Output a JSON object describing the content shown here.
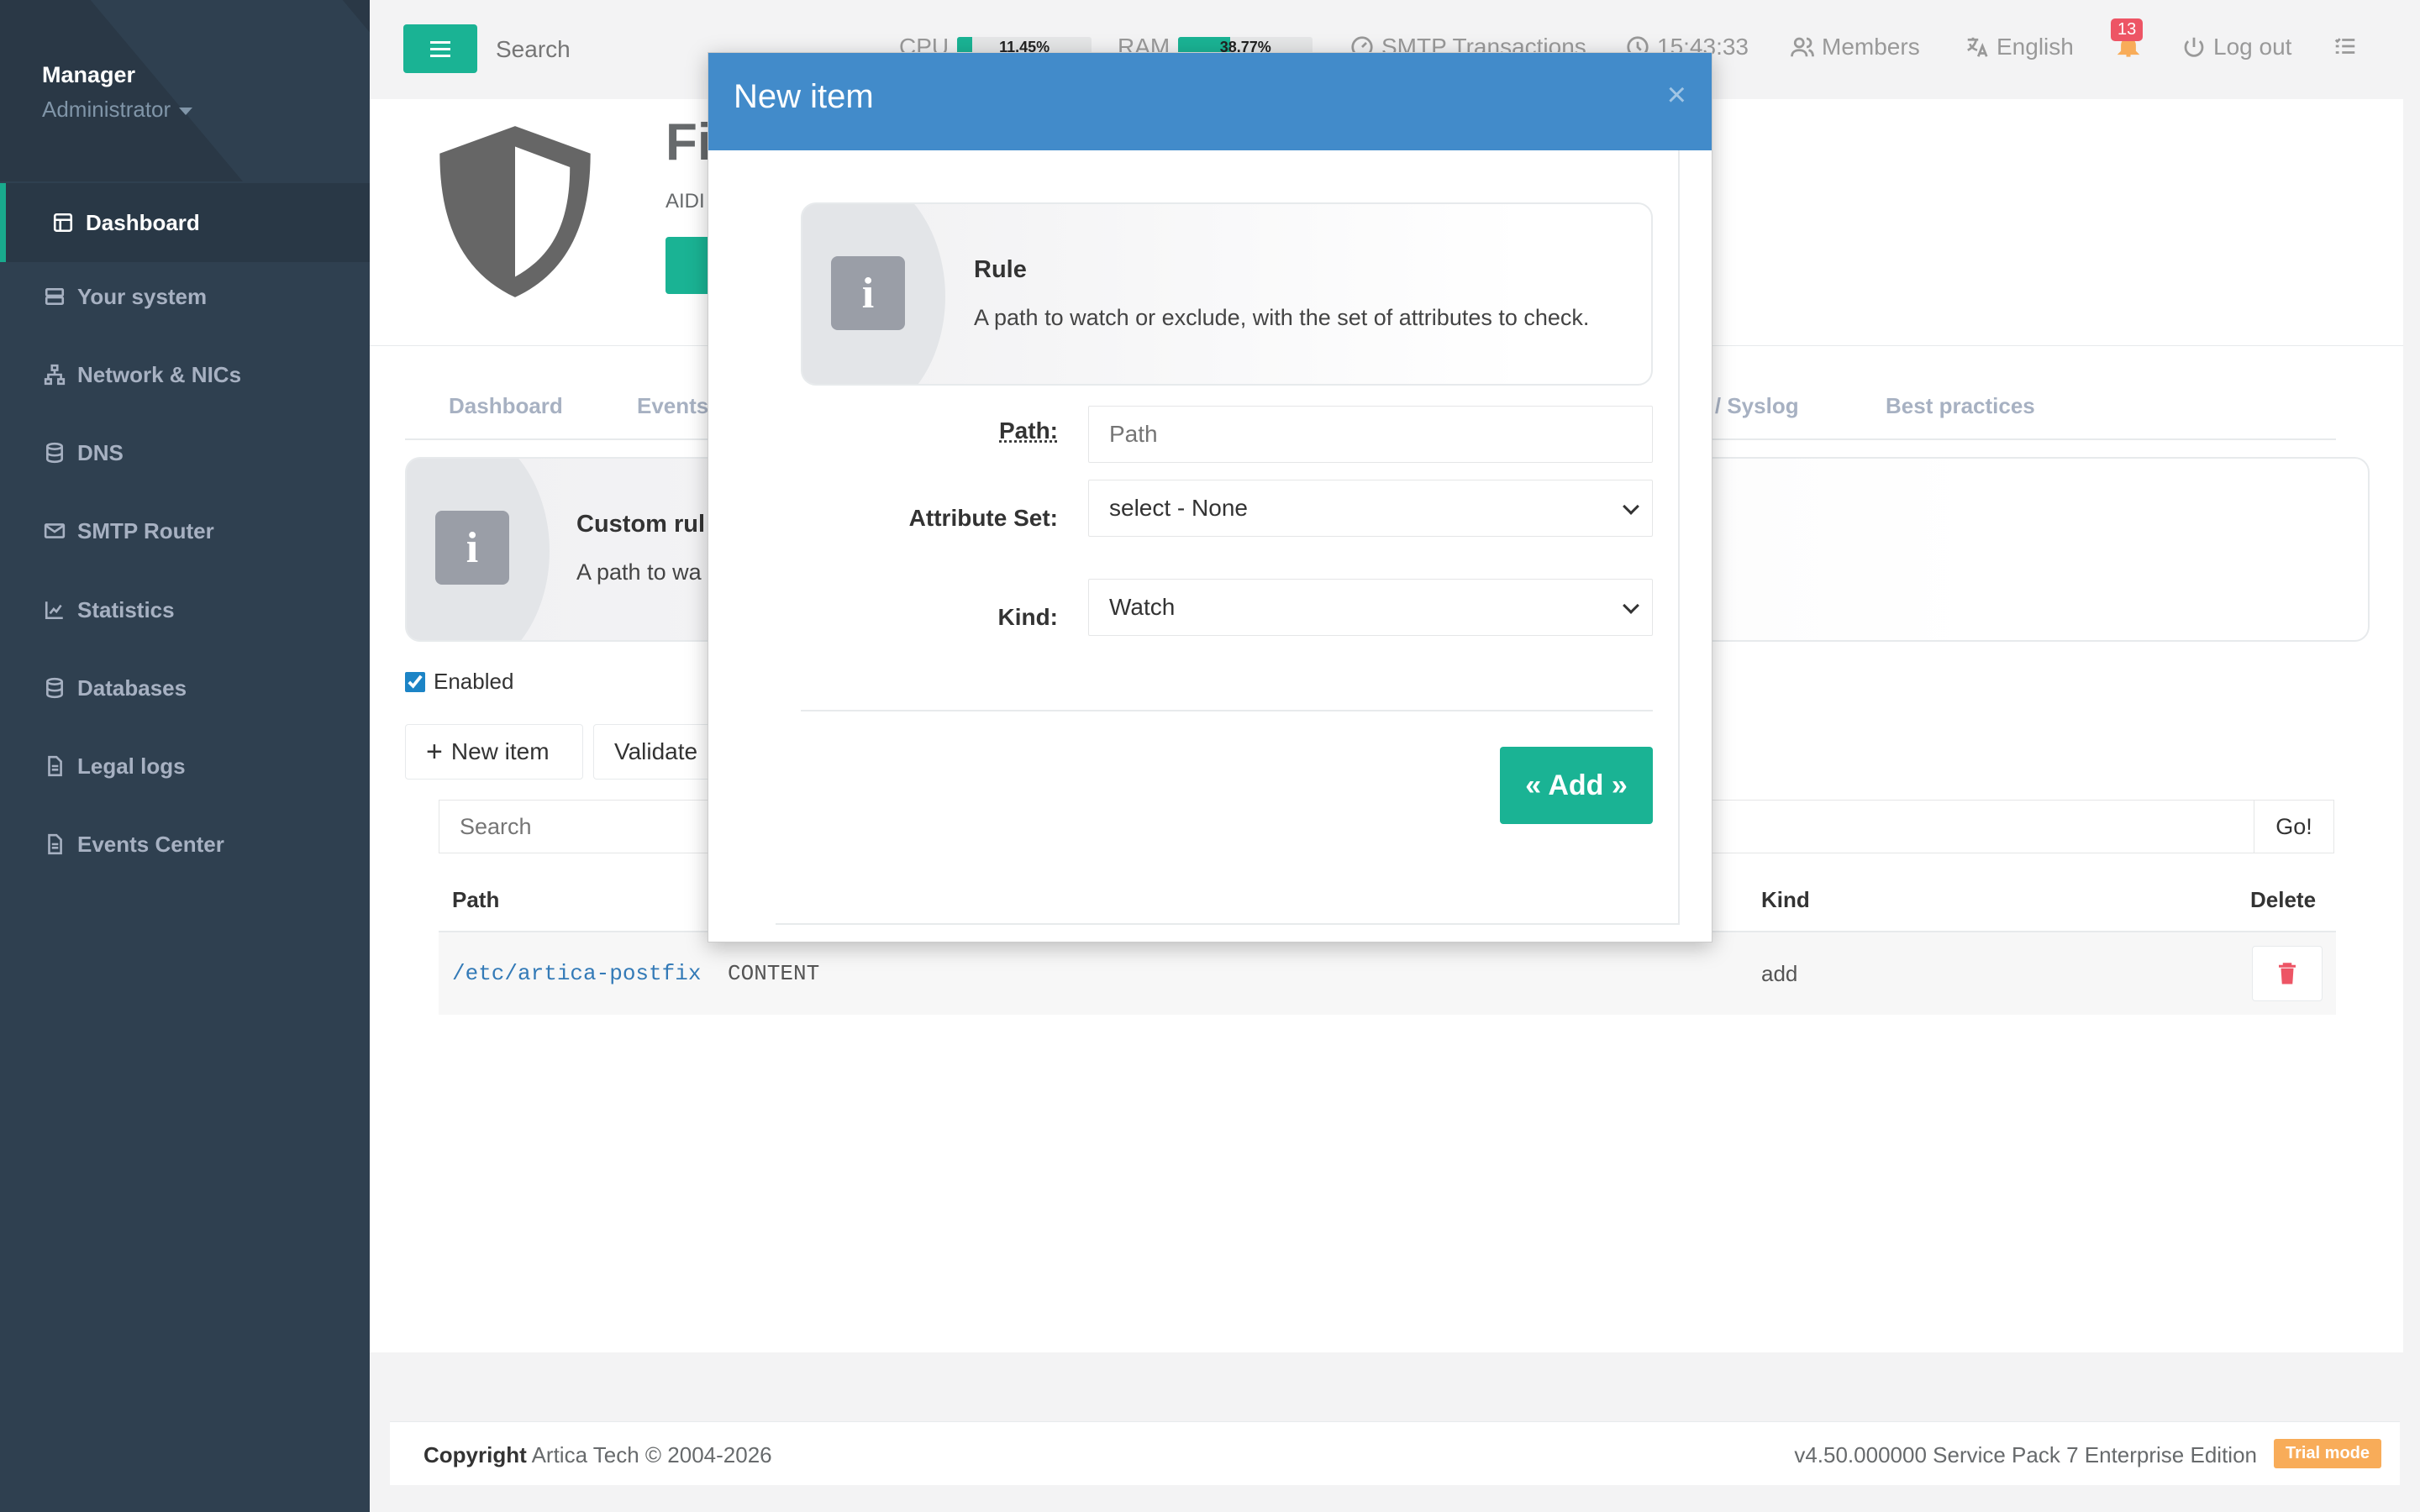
{
  "sidebar": {
    "profile_name": "Manager",
    "profile_role": "Administrator",
    "items": [
      {
        "label": "Dashboard",
        "icon": "dashboard-icon"
      },
      {
        "label": "Your system",
        "icon": "server-icon"
      },
      {
        "label": "Network & NICs",
        "icon": "sitemap-icon"
      },
      {
        "label": "DNS",
        "icon": "database-icon"
      },
      {
        "label": "SMTP Router",
        "icon": "envelope-icon"
      },
      {
        "label": "Statistics",
        "icon": "chart-icon"
      },
      {
        "label": "Databases",
        "icon": "database-icon"
      },
      {
        "label": "Legal logs",
        "icon": "file-icon"
      },
      {
        "label": "Events Center",
        "icon": "file-icon"
      }
    ]
  },
  "topbar": {
    "search_placeholder": "Search",
    "cpu_label": "CPU",
    "cpu_value": "11.45%",
    "cpu_fraction": 0.1145,
    "ram_label": "RAM",
    "ram_value": "38.77%",
    "ram_fraction": 0.3877,
    "smtp_label": "SMTP Transactions",
    "time": "15:43:33",
    "members_label": "Members",
    "language_label": "English",
    "notifications_count": "13",
    "logout_label": "Log out"
  },
  "header": {
    "title_visible": "Fi",
    "subtitle_visible": "AIDI"
  },
  "tabs": [
    "Dashboard",
    "Events",
    "M / Syslog",
    "Best practices"
  ],
  "page_info": {
    "title_visible": "Custom rul",
    "text_visible": "A path to wa"
  },
  "enabled_label": "Enabled",
  "toolbar": {
    "new_item_label": "New item",
    "validate_label": "Validate"
  },
  "table": {
    "search_placeholder": "Search",
    "go_label": "Go!",
    "columns": {
      "path": "Path",
      "kind": "Kind",
      "delete": "Delete"
    },
    "rows": [
      {
        "path": "/etc/artica-postfix",
        "attributes": "CONTENT",
        "kind": "add"
      }
    ]
  },
  "footer": {
    "copyright_bold": "Copyright",
    "copyright_text": "Artica Tech © 2004-2026",
    "version": "v4.50.000000 Service Pack 7 Enterprise Edition",
    "trial_badge": "Trial mode"
  },
  "modal": {
    "title": "New item",
    "close": "×",
    "info_title": "Rule",
    "info_text": "A path to watch or exclude, with the set of attributes to check.",
    "path_label": "Path:",
    "path_placeholder": "Path",
    "attribute_label": "Attribute Set:",
    "attribute_value": "select - None",
    "kind_label": "Kind:",
    "kind_value": "Watch",
    "add_label": "« Add »"
  },
  "colors": {
    "sidebar": "#2f4050",
    "accent": "#1ab394",
    "modal_header": "#428bca",
    "danger": "#ed5565",
    "trial": "#f8ac59"
  }
}
